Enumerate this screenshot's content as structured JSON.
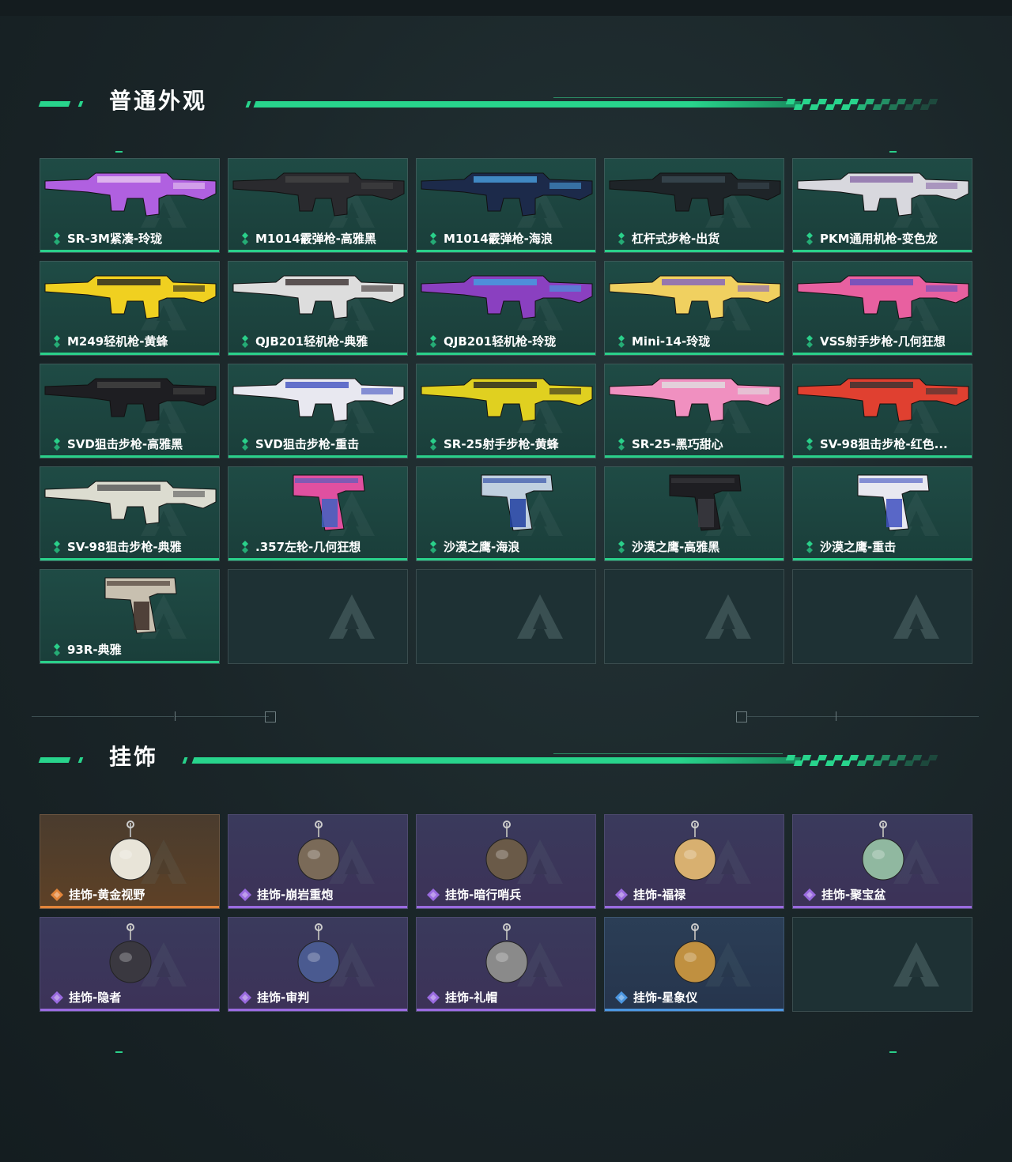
{
  "sections": {
    "skins": {
      "title": "普通外观"
    },
    "charms": {
      "title": "挂饰"
    }
  },
  "colors": {
    "accent": "#28d48c",
    "rarity_green": "#2ad08a",
    "rarity_gold": "#e3853a",
    "rarity_purple": "#9a6be0",
    "rarity_blue": "#4b96e0"
  },
  "skins": [
    {
      "label": "SR-3M紧凑-玲珑",
      "icon": "smg-icon",
      "rarity": "green"
    },
    {
      "label": "M1014霰弹枪-高雅黑",
      "icon": "shotgun-icon",
      "rarity": "green"
    },
    {
      "label": "M1014霰弹枪-海浪",
      "icon": "shotgun-icon",
      "rarity": "green"
    },
    {
      "label": "杠杆式步枪-出货",
      "icon": "rifle-icon",
      "rarity": "green"
    },
    {
      "label": "PKM通用机枪-变色龙",
      "icon": "machine-gun-icon",
      "rarity": "green"
    },
    {
      "label": "M249轻机枪-黄蜂",
      "icon": "machine-gun-icon",
      "rarity": "green"
    },
    {
      "label": "QJB201轻机枪-典雅",
      "icon": "machine-gun-icon",
      "rarity": "green"
    },
    {
      "label": "QJB201轻机枪-玲珑",
      "icon": "machine-gun-icon",
      "rarity": "green"
    },
    {
      "label": "Mini-14-玲珑",
      "icon": "rifle-icon",
      "rarity": "green"
    },
    {
      "label": "VSS射手步枪-几何狂想",
      "icon": "rifle-icon",
      "rarity": "green"
    },
    {
      "label": "SVD狙击步枪-高雅黑",
      "icon": "sniper-icon",
      "rarity": "green"
    },
    {
      "label": "SVD狙击步枪-重击",
      "icon": "sniper-icon",
      "rarity": "green"
    },
    {
      "label": "SR-25射手步枪-黄蜂",
      "icon": "rifle-icon",
      "rarity": "green"
    },
    {
      "label": "SR-25-黑巧甜心",
      "icon": "rifle-icon",
      "rarity": "green"
    },
    {
      "label": "SV-98狙击步枪-红色...",
      "icon": "sniper-icon",
      "rarity": "green"
    },
    {
      "label": "SV-98狙击步枪-典雅",
      "icon": "sniper-icon",
      "rarity": "green"
    },
    {
      "label": ".357左轮-几何狂想",
      "icon": "revolver-icon",
      "rarity": "green"
    },
    {
      "label": "沙漠之鹰-海浪",
      "icon": "pistol-icon",
      "rarity": "green"
    },
    {
      "label": "沙漠之鹰-高雅黑",
      "icon": "pistol-icon",
      "rarity": "green"
    },
    {
      "label": "沙漠之鹰-重击",
      "icon": "pistol-icon",
      "rarity": "green"
    },
    {
      "label": "93R-典雅",
      "icon": "pistol-icon",
      "rarity": "green"
    },
    {
      "label": "",
      "icon": "logo-watermark-icon",
      "rarity": "empty"
    },
    {
      "label": "",
      "icon": "logo-watermark-icon",
      "rarity": "empty"
    },
    {
      "label": "",
      "icon": "logo-watermark-icon",
      "rarity": "empty"
    },
    {
      "label": "",
      "icon": "logo-watermark-icon",
      "rarity": "empty"
    }
  ],
  "charms": [
    {
      "label": "挂饰-黄金视野",
      "icon": "charm-icon",
      "rarity": "gold"
    },
    {
      "label": "挂饰-崩岩重炮",
      "icon": "charm-icon",
      "rarity": "purple"
    },
    {
      "label": "挂饰-暗行哨兵",
      "icon": "charm-icon",
      "rarity": "purple"
    },
    {
      "label": "挂饰-福禄",
      "icon": "charm-icon",
      "rarity": "purple"
    },
    {
      "label": "挂饰-聚宝盆",
      "icon": "charm-icon",
      "rarity": "purple"
    },
    {
      "label": "挂饰-隐者",
      "icon": "charm-icon",
      "rarity": "purple"
    },
    {
      "label": "挂饰-审判",
      "icon": "charm-icon",
      "rarity": "purple"
    },
    {
      "label": "挂饰-礼帽",
      "icon": "charm-icon",
      "rarity": "purple"
    },
    {
      "label": "挂饰-星象仪",
      "icon": "charm-icon",
      "rarity": "blue"
    },
    {
      "label": "",
      "icon": "logo-watermark-icon",
      "rarity": "empty"
    }
  ]
}
